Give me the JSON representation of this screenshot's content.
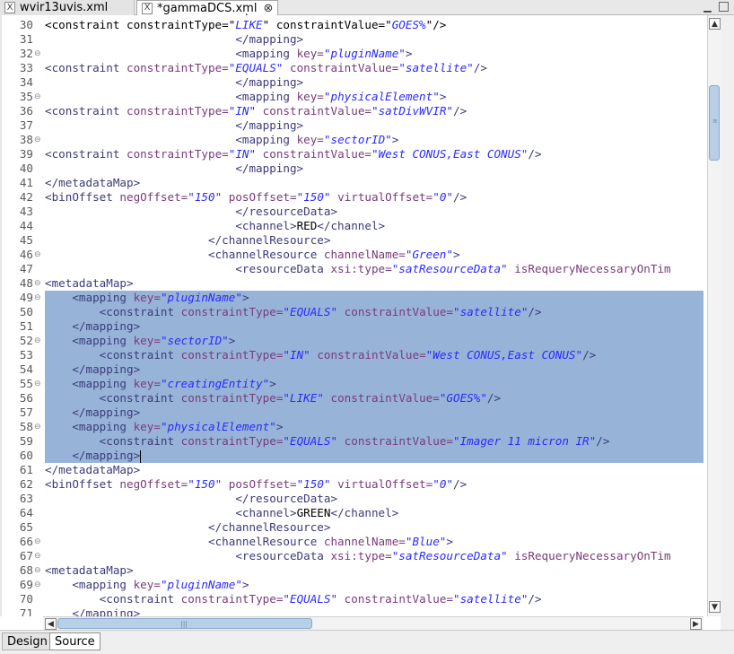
{
  "tabs": [
    {
      "label": "wvir13uvis.xml",
      "icon": "xml-file-icon",
      "active": false
    },
    {
      "label": "*gammaDCS.xml",
      "icon": "xml-file-icon",
      "active": true
    }
  ],
  "tab_icon_glyph": "X",
  "close_glyph": "⊗",
  "window": {
    "minimize": "▁",
    "maximize": ""
  },
  "bottom_tabs": {
    "design": "Design",
    "source": "Source"
  },
  "colors": {
    "selection": "#97b4d8",
    "tag": "#3b3b7a",
    "attr": "#7a3a7a",
    "value": "#2a2aff"
  },
  "lines": [
    {
      "n": "30",
      "f": "",
      "sel": false,
      "tk": [
        [
          "x",
          "<constraint constraintType=\""
        ],
        [
          "v",
          "LIKE"
        ],
        [
          "x",
          "\" constraintValue=\""
        ],
        [
          "v",
          "GOES%"
        ],
        [
          "x",
          "\"/>"
        ]
      ]
    },
    {
      "n": "31",
      "f": "",
      "sel": false,
      "tk": [
        [
          "x",
          "                            "
        ],
        [
          "t",
          "</mapping>"
        ]
      ]
    },
    {
      "n": "32",
      "f": "⊖",
      "sel": false,
      "tk": [
        [
          "x",
          "                            "
        ],
        [
          "t",
          "<mapping "
        ],
        [
          "a",
          "key="
        ],
        [
          "v",
          "\"pluginName\""
        ],
        [
          "t",
          ">"
        ]
      ]
    },
    {
      "n": "33",
      "f": "",
      "sel": false,
      "tk": [
        [
          "t",
          "<constraint "
        ],
        [
          "a",
          "constraintType="
        ],
        [
          "v",
          "\"EQUALS\""
        ],
        [
          "x",
          " "
        ],
        [
          "a",
          "constraintValue="
        ],
        [
          "v",
          "\"satellite\""
        ],
        [
          "t",
          "/>"
        ]
      ]
    },
    {
      "n": "34",
      "f": "",
      "sel": false,
      "tk": [
        [
          "x",
          "                            "
        ],
        [
          "t",
          "</mapping>"
        ]
      ]
    },
    {
      "n": "35",
      "f": "⊖",
      "sel": false,
      "tk": [
        [
          "x",
          "                            "
        ],
        [
          "t",
          "<mapping "
        ],
        [
          "a",
          "key="
        ],
        [
          "v",
          "\"physicalElement\""
        ],
        [
          "t",
          ">"
        ]
      ]
    },
    {
      "n": "36",
      "f": "",
      "sel": false,
      "tk": [
        [
          "t",
          "<constraint "
        ],
        [
          "a",
          "constraintType="
        ],
        [
          "v",
          "\"IN\""
        ],
        [
          "x",
          " "
        ],
        [
          "a",
          "constraintValue="
        ],
        [
          "v",
          "\"satDivWVIR\""
        ],
        [
          "t",
          "/>"
        ]
      ]
    },
    {
      "n": "37",
      "f": "",
      "sel": false,
      "tk": [
        [
          "x",
          "                            "
        ],
        [
          "t",
          "</mapping>"
        ]
      ]
    },
    {
      "n": "38",
      "f": "⊖",
      "sel": false,
      "tk": [
        [
          "x",
          "                            "
        ],
        [
          "t",
          "<mapping "
        ],
        [
          "a",
          "key="
        ],
        [
          "v",
          "\"sectorID\""
        ],
        [
          "t",
          ">"
        ]
      ]
    },
    {
      "n": "39",
      "f": "",
      "sel": false,
      "tk": [
        [
          "t",
          "<constraint "
        ],
        [
          "a",
          "constraintType="
        ],
        [
          "v",
          "\"IN\""
        ],
        [
          "x",
          " "
        ],
        [
          "a",
          "constraintValue="
        ],
        [
          "v",
          "\"West CONUS,East CONUS\""
        ],
        [
          "t",
          "/>"
        ]
      ]
    },
    {
      "n": "40",
      "f": "",
      "sel": false,
      "tk": [
        [
          "x",
          "                            "
        ],
        [
          "t",
          "</mapping>"
        ]
      ]
    },
    {
      "n": "41",
      "f": "",
      "sel": false,
      "tk": [
        [
          "t",
          "</metadataMap>"
        ]
      ]
    },
    {
      "n": "42",
      "f": "",
      "sel": false,
      "tk": [
        [
          "t",
          "<binOffset "
        ],
        [
          "a",
          "negOffset="
        ],
        [
          "v",
          "\"150\""
        ],
        [
          "x",
          " "
        ],
        [
          "a",
          "posOffset="
        ],
        [
          "v",
          "\"150\""
        ],
        [
          "x",
          " "
        ],
        [
          "a",
          "virtualOffset="
        ],
        [
          "v",
          "\"0\""
        ],
        [
          "t",
          "/>"
        ]
      ]
    },
    {
      "n": "43",
      "f": "",
      "sel": false,
      "tk": [
        [
          "x",
          "                            "
        ],
        [
          "t",
          "</resourceData>"
        ]
      ]
    },
    {
      "n": "44",
      "f": "",
      "sel": false,
      "tk": [
        [
          "x",
          "                            "
        ],
        [
          "t",
          "<channel>"
        ],
        [
          "x",
          "RED"
        ],
        [
          "t",
          "</channel>"
        ]
      ]
    },
    {
      "n": "45",
      "f": "",
      "sel": false,
      "tk": [
        [
          "x",
          "                        "
        ],
        [
          "t",
          "</channelResource>"
        ]
      ]
    },
    {
      "n": "46",
      "f": "⊖",
      "sel": false,
      "tk": [
        [
          "x",
          "                        "
        ],
        [
          "t",
          "<channelResource "
        ],
        [
          "a",
          "channelName="
        ],
        [
          "v",
          "\"Green\""
        ],
        [
          "t",
          ">"
        ]
      ]
    },
    {
      "n": "47",
      "f": "",
      "sel": false,
      "tk": [
        [
          "x",
          "                            "
        ],
        [
          "t",
          "<resourceData "
        ],
        [
          "a",
          "xsi:type="
        ],
        [
          "v",
          "\"satResourceData\""
        ],
        [
          "x",
          " "
        ],
        [
          "a",
          "isRequeryNecessaryOnTim"
        ]
      ]
    },
    {
      "n": "48",
      "f": "⊖",
      "sel": false,
      "tk": [
        [
          "t",
          "<metadataMap>"
        ]
      ]
    },
    {
      "n": "49",
      "f": "⊖",
      "sel": true,
      "tk": [
        [
          "x",
          "    "
        ],
        [
          "t",
          "<mapping "
        ],
        [
          "a",
          "key="
        ],
        [
          "v",
          "\"pluginName\""
        ],
        [
          "t",
          ">"
        ]
      ]
    },
    {
      "n": "50",
      "f": "",
      "sel": true,
      "tk": [
        [
          "x",
          "        "
        ],
        [
          "t",
          "<constraint "
        ],
        [
          "a",
          "constraintType="
        ],
        [
          "v",
          "\"EQUALS\""
        ],
        [
          "x",
          " "
        ],
        [
          "a",
          "constraintValue="
        ],
        [
          "v",
          "\"satellite\""
        ],
        [
          "t",
          "/>"
        ]
      ]
    },
    {
      "n": "51",
      "f": "",
      "sel": true,
      "tk": [
        [
          "x",
          "    "
        ],
        [
          "t",
          "</mapping>"
        ]
      ]
    },
    {
      "n": "52",
      "f": "⊖",
      "sel": true,
      "tk": [
        [
          "x",
          "    "
        ],
        [
          "t",
          "<mapping "
        ],
        [
          "a",
          "key="
        ],
        [
          "v",
          "\"sectorID\""
        ],
        [
          "t",
          ">"
        ]
      ]
    },
    {
      "n": "53",
      "f": "",
      "sel": true,
      "tk": [
        [
          "x",
          "        "
        ],
        [
          "t",
          "<constraint "
        ],
        [
          "a",
          "constraintType="
        ],
        [
          "v",
          "\"IN\""
        ],
        [
          "x",
          " "
        ],
        [
          "a",
          "constraintValue="
        ],
        [
          "v",
          "\"West CONUS,East CONUS\""
        ],
        [
          "t",
          "/>"
        ]
      ]
    },
    {
      "n": "54",
      "f": "",
      "sel": true,
      "tk": [
        [
          "x",
          "    "
        ],
        [
          "t",
          "</mapping>"
        ]
      ]
    },
    {
      "n": "55",
      "f": "⊖",
      "sel": true,
      "tk": [
        [
          "x",
          "    "
        ],
        [
          "t",
          "<mapping "
        ],
        [
          "a",
          "key="
        ],
        [
          "v",
          "\"creatingEntity\""
        ],
        [
          "t",
          ">"
        ]
      ]
    },
    {
      "n": "56",
      "f": "",
      "sel": true,
      "tk": [
        [
          "x",
          "        "
        ],
        [
          "t",
          "<constraint "
        ],
        [
          "a",
          "constraintType="
        ],
        [
          "v",
          "\"LIKE\""
        ],
        [
          "x",
          " "
        ],
        [
          "a",
          "constraintValue="
        ],
        [
          "v",
          "\"GOES%\""
        ],
        [
          "t",
          "/>"
        ]
      ]
    },
    {
      "n": "57",
      "f": "",
      "sel": true,
      "tk": [
        [
          "x",
          "    "
        ],
        [
          "t",
          "</mapping>"
        ]
      ]
    },
    {
      "n": "58",
      "f": "⊖",
      "sel": true,
      "tk": [
        [
          "x",
          "    "
        ],
        [
          "t",
          "<mapping "
        ],
        [
          "a",
          "key="
        ],
        [
          "v",
          "\"physicalElement\""
        ],
        [
          "t",
          ">"
        ]
      ]
    },
    {
      "n": "59",
      "f": "",
      "sel": true,
      "tk": [
        [
          "x",
          "        "
        ],
        [
          "t",
          "<constraint "
        ],
        [
          "a",
          "constraintType="
        ],
        [
          "v",
          "\"EQUALS\""
        ],
        [
          "x",
          " "
        ],
        [
          "a",
          "constraintValue="
        ],
        [
          "v",
          "\"Imager 11 micron IR\""
        ],
        [
          "t",
          "/>"
        ]
      ]
    },
    {
      "n": "60",
      "f": "",
      "sel": true,
      "caret": true,
      "tk": [
        [
          "x",
          "    "
        ],
        [
          "t",
          "</mapping>"
        ]
      ]
    },
    {
      "n": "61",
      "f": "",
      "sel": false,
      "tk": [
        [
          "t",
          "</metadataMap>"
        ]
      ]
    },
    {
      "n": "62",
      "f": "",
      "sel": false,
      "tk": [
        [
          "t",
          "<binOffset "
        ],
        [
          "a",
          "negOffset="
        ],
        [
          "v",
          "\"150\""
        ],
        [
          "x",
          " "
        ],
        [
          "a",
          "posOffset="
        ],
        [
          "v",
          "\"150\""
        ],
        [
          "x",
          " "
        ],
        [
          "a",
          "virtualOffset="
        ],
        [
          "v",
          "\"0\""
        ],
        [
          "t",
          "/>"
        ]
      ]
    },
    {
      "n": "63",
      "f": "",
      "sel": false,
      "tk": [
        [
          "x",
          "                            "
        ],
        [
          "t",
          "</resourceData>"
        ]
      ]
    },
    {
      "n": "64",
      "f": "",
      "sel": false,
      "tk": [
        [
          "x",
          "                            "
        ],
        [
          "t",
          "<channel>"
        ],
        [
          "x",
          "GREEN"
        ],
        [
          "t",
          "</channel>"
        ]
      ]
    },
    {
      "n": "65",
      "f": "",
      "sel": false,
      "tk": [
        [
          "x",
          "                        "
        ],
        [
          "t",
          "</channelResource>"
        ]
      ]
    },
    {
      "n": "66",
      "f": "⊖",
      "sel": false,
      "tk": [
        [
          "x",
          "                        "
        ],
        [
          "t",
          "<channelResource "
        ],
        [
          "a",
          "channelName="
        ],
        [
          "v",
          "\"Blue\""
        ],
        [
          "t",
          ">"
        ]
      ]
    },
    {
      "n": "67",
      "f": "⊖",
      "sel": false,
      "tk": [
        [
          "x",
          "                            "
        ],
        [
          "t",
          "<resourceData "
        ],
        [
          "a",
          "xsi:type="
        ],
        [
          "v",
          "\"satResourceData\""
        ],
        [
          "x",
          " "
        ],
        [
          "a",
          "isRequeryNecessaryOnTim"
        ]
      ]
    },
    {
      "n": "68",
      "f": "⊖",
      "sel": false,
      "tk": [
        [
          "t",
          "<metadataMap>"
        ]
      ]
    },
    {
      "n": "69",
      "f": "⊖",
      "sel": false,
      "tk": [
        [
          "x",
          "    "
        ],
        [
          "t",
          "<mapping "
        ],
        [
          "a",
          "key="
        ],
        [
          "v",
          "\"pluginName\""
        ],
        [
          "t",
          ">"
        ]
      ]
    },
    {
      "n": "70",
      "f": "",
      "sel": false,
      "tk": [
        [
          "x",
          "        "
        ],
        [
          "t",
          "<constraint "
        ],
        [
          "a",
          "constraintType="
        ],
        [
          "v",
          "\"EQUALS\""
        ],
        [
          "x",
          " "
        ],
        [
          "a",
          "constraintValue="
        ],
        [
          "v",
          "\"satellite\""
        ],
        [
          "t",
          "/>"
        ]
      ]
    },
    {
      "n": "71",
      "f": "",
      "sel": false,
      "tk": [
        [
          "x",
          "    "
        ],
        [
          "t",
          "</mapping>"
        ]
      ]
    }
  ]
}
